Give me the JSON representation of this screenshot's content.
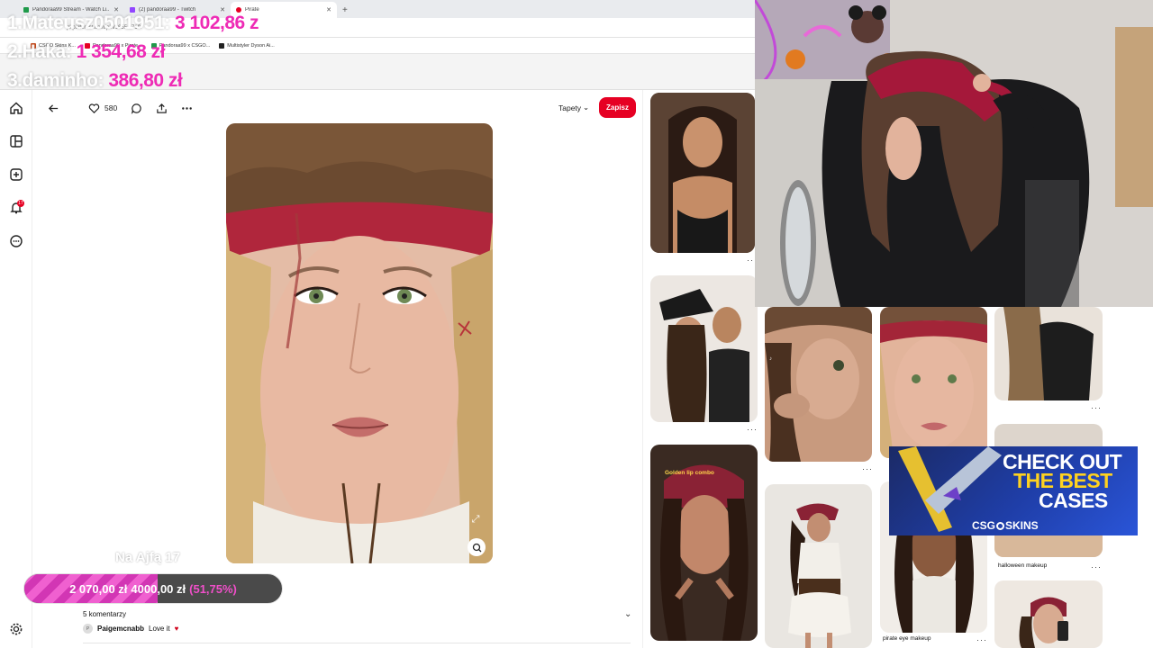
{
  "browser": {
    "tabs": [
      {
        "title": "Pandoraa99 Stream - Watch Li...",
        "color": "#1f9a4a"
      },
      {
        "title": "(2) pandoraa99 - Twitch",
        "color": "#9146ff"
      },
      {
        "title": "Pirate",
        "color": "#e60023"
      }
    ],
    "url": "pl.pinterest.com/pin/1655...719/",
    "bookmarks": [
      {
        "label": "CSGO Skins K...",
        "color": "#c94a1a"
      },
      {
        "label": "Pandoraa99 x Pirate...",
        "color": "#e60023"
      },
      {
        "label": "Pandoraa99 x CSGO...",
        "color": "#1f9a4a"
      },
      {
        "label": "Multistyler Dyson Ai...",
        "color": "#222222"
      }
    ]
  },
  "donations": [
    {
      "name": "1.Mateusz0501951:",
      "amount": "3 102,86 z"
    },
    {
      "name": "2.Haka:",
      "amount": "1 354,68 zł"
    },
    {
      "name": "3.daminho:",
      "amount": "386,80 zł"
    }
  ],
  "pin": {
    "likes": "580",
    "board": "Tapety",
    "save_label": "Zapisz",
    "comments_count": "5 komentarzy",
    "comment": {
      "avatar": "P",
      "author": "Paigemcnabb",
      "text": "Love it"
    }
  },
  "overlay": {
    "watermark": "Na Ajfą 17",
    "goal": {
      "current": "2 070,00 zł",
      "target": "4000,00 zł",
      "percent": "(51,75%)",
      "fraction": 0.5175
    }
  },
  "rail": {
    "notification_count": "17"
  },
  "grid": {
    "captions": {
      "halloween": "halloween makeup",
      "pirate_eye": "pirate eye makeup",
      "golden": "Golden lip combo"
    }
  },
  "ad": {
    "line1": "CHECK OUT",
    "line2": "THE BEST",
    "line3": "CASES",
    "brand_left": "CSG",
    "brand_right": "SKINS"
  },
  "colors": {
    "pinterest_red": "#e60023",
    "donation_pink": "#ee2bb5"
  }
}
